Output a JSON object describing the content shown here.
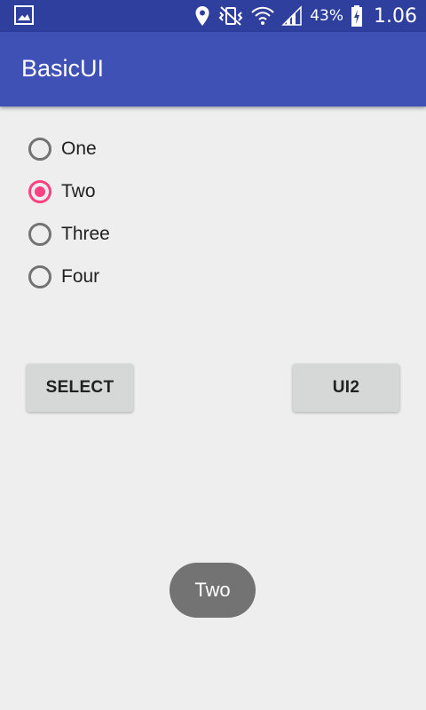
{
  "status_bar": {
    "battery_percent": "43%",
    "time": "1.06",
    "icons": [
      "gallery-icon",
      "location-icon",
      "vibrate-icon",
      "wifi-icon",
      "signal-icon",
      "battery-charging-icon"
    ],
    "background_color": "#2f3f9e"
  },
  "app_bar": {
    "title": "BasicUI",
    "background_color": "#3f51b5"
  },
  "radio_group": {
    "options": [
      {
        "label": "One",
        "checked": false
      },
      {
        "label": "Two",
        "checked": true
      },
      {
        "label": "Three",
        "checked": false
      },
      {
        "label": "Four",
        "checked": false
      }
    ],
    "accent_color": "#ff4081"
  },
  "buttons": {
    "select_label": "SELECT",
    "ui2_label": "UI2"
  },
  "toast": {
    "text": "Two"
  }
}
